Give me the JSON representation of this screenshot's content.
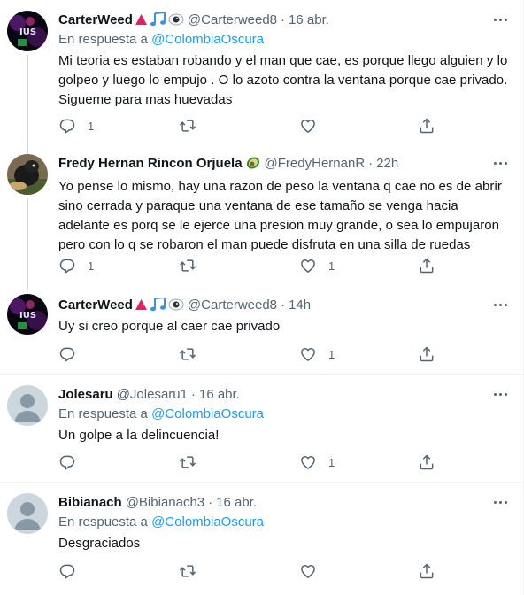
{
  "tweets": [
    {
      "name": "CarterWeed",
      "emojis": [
        "red-triangle-icon",
        "music-notes-icon",
        "eye-icon"
      ],
      "handle": "@Carterweed8",
      "time": "16 abr.",
      "reply_prefix": "En respuesta a",
      "reply_to": "@ColombiaOscura",
      "text": "Mi teoria es estaban robando y el man que cae, es porque llego alguien y lo golpeo y luego lo empujo . O lo azoto contra la ventana porque cae privado. Sigueme para mas huevadas",
      "counts": {
        "reply": "1",
        "retweet": "",
        "like": ""
      }
    },
    {
      "name": "Fredy Hernan Rincon Orjuela",
      "emojis": [
        "avocado-icon"
      ],
      "handle": "@FredyHernanR",
      "time": "22h",
      "reply_prefix": "",
      "reply_to": "",
      "text": "Yo pense lo mismo, hay una razon de peso la ventana q cae no es de abrir sino cerrada y paraque una ventana de ese tamaño se venga hacia adelante es porq se le ejerce una presion muy grande, o sea lo empujaron pero con lo q se robaron el man puede disfruta en una silla de ruedas",
      "counts": {
        "reply": "1",
        "retweet": "",
        "like": "1"
      }
    },
    {
      "name": "CarterWeed",
      "emojis": [
        "red-triangle-icon",
        "music-notes-icon",
        "eye-icon"
      ],
      "handle": "@Carterweed8",
      "time": "14h",
      "reply_prefix": "",
      "reply_to": "",
      "text": "Uy si creo porque al caer cae privado",
      "counts": {
        "reply": "",
        "retweet": "",
        "like": "1"
      }
    },
    {
      "name": "Jolesaru",
      "emojis": [],
      "handle": "@Jolesaru1",
      "time": "16 abr.",
      "reply_prefix": "En respuesta a",
      "reply_to": "@ColombiaOscura",
      "text": "Un golpe a la delincuencia!",
      "counts": {
        "reply": "",
        "retweet": "",
        "like": "1"
      }
    },
    {
      "name": "Bibianach",
      "emojis": [],
      "handle": "@Bibianach3",
      "time": "16 abr.",
      "reply_prefix": "En respuesta a",
      "reply_to": "@ColombiaOscura",
      "text": "Desgraciados",
      "counts": {
        "reply": "",
        "retweet": "",
        "like": ""
      }
    }
  ],
  "colors": {
    "link": "#1d9bf0",
    "secondary": "#536471",
    "text": "#0f1419",
    "thread": "#cfd9de",
    "divider": "#eff3f4"
  }
}
